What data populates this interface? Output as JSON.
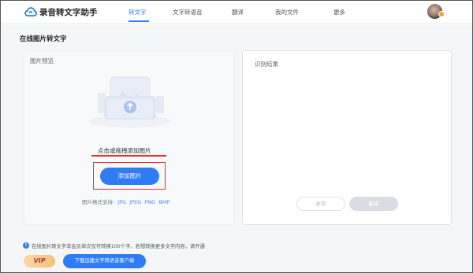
{
  "header": {
    "app_title": "录音转文字助手",
    "nav": [
      {
        "label": "转文字",
        "active": true
      },
      {
        "label": "文字转语音"
      },
      {
        "label": "翻译"
      },
      {
        "label": "我的文件"
      },
      {
        "label": "更多"
      }
    ]
  },
  "page": {
    "title": "在线图片转文字"
  },
  "left_panel": {
    "label": "图片预览",
    "drop_text": "点击或拖拽添加图片",
    "add_button": "添加图片",
    "formats_prefix": "图片格式支持:",
    "formats": [
      "JPG",
      "JPEG",
      "PNG",
      "BMP"
    ]
  },
  "right_panel": {
    "label": "识别结果",
    "copy_button": "复制",
    "translate_button": "翻译"
  },
  "footer": {
    "notice": "在线图片转文字非会员单次仅可转换100个字，若想转换更多文字内容，请开通",
    "vip_label": "VIP",
    "download_button": "下载迅捷文字转语音客户端"
  },
  "colors": {
    "accent": "#2f7cf6",
    "highlight_red": "#e03030"
  }
}
